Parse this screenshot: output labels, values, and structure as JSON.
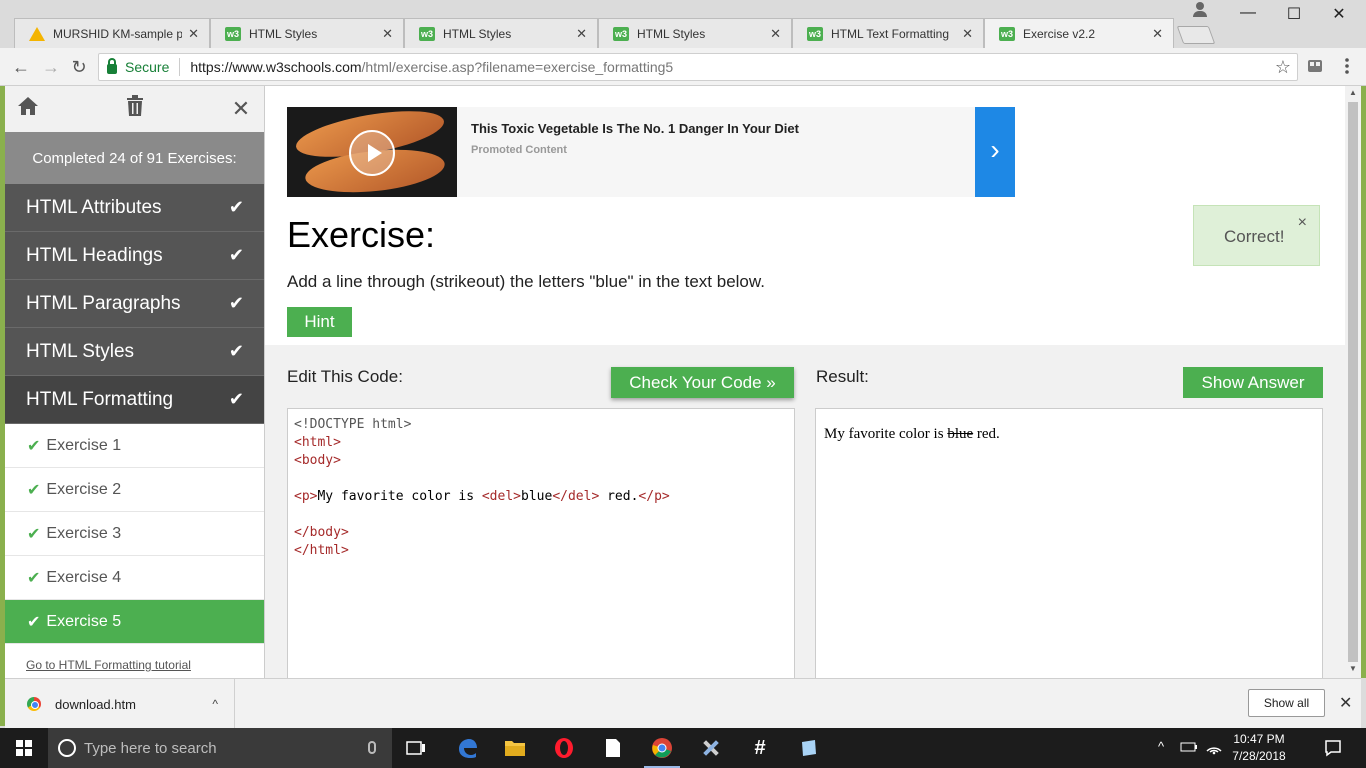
{
  "browser": {
    "tabs": [
      {
        "label": "MURSHID KM-sample pr",
        "icon": "google-drive-icon"
      },
      {
        "label": "HTML Styles",
        "icon": "w3schools-icon"
      },
      {
        "label": "HTML Styles",
        "icon": "w3schools-icon"
      },
      {
        "label": "HTML Styles",
        "icon": "w3schools-icon"
      },
      {
        "label": "HTML Text Formatting",
        "icon": "w3schools-icon"
      },
      {
        "label": "Exercise v2.2",
        "icon": "w3schools-icon",
        "active": true
      }
    ],
    "tab_close": "✕",
    "favicon_text": "w3",
    "address": {
      "secure_label": "Secure",
      "url_host": "https://www.w3schools.com",
      "url_path": "/html/exercise.asp?filename=exercise_formatting5"
    },
    "window_controls": {
      "minimize": "—",
      "maximize": "☐",
      "close": "✕"
    },
    "nav": {
      "back": "←",
      "forward": "→",
      "reload": "↻",
      "star": "☆"
    }
  },
  "sidebar": {
    "icons": {
      "home": "⌂",
      "trash": "🗑",
      "close": "✕"
    },
    "progress_text": "Completed 24 of 91 Exercises:",
    "chapters": [
      {
        "label": "HTML Attributes",
        "done": true
      },
      {
        "label": "HTML Headings",
        "done": true
      },
      {
        "label": "HTML Paragraphs",
        "done": true
      },
      {
        "label": "HTML Styles",
        "done": true
      },
      {
        "label": "HTML Formatting",
        "done": true,
        "current": true
      }
    ],
    "checkmark": "✔",
    "exercises": [
      {
        "label": "Exercise 1",
        "done": true
      },
      {
        "label": "Exercise 2",
        "done": true
      },
      {
        "label": "Exercise 3",
        "done": true
      },
      {
        "label": "Exercise 4",
        "done": true
      },
      {
        "label": "Exercise 5",
        "done": true,
        "active": true
      }
    ],
    "tutorial_link": "Go to HTML Formatting tutorial"
  },
  "ad": {
    "title": "This Toxic Vegetable Is The No. 1 Danger In Your Diet",
    "subtitle": "Promoted Content",
    "arrow": "›"
  },
  "exercise": {
    "heading": "Exercise:",
    "instruction": "Add a line through (strikeout) the letters \"blue\" in the text below.",
    "hint_label": "Hint",
    "correct_message": "Correct!",
    "correct_close": "×"
  },
  "editor": {
    "label": "Edit This Code:",
    "check_label": "Check Your Code »",
    "code": {
      "line1": "<!DOCTYPE html>",
      "html_open": "<html>",
      "body_open": "<body>",
      "p_open": "<p>",
      "text_before": "My favorite color is ",
      "del_open": "<del>",
      "del_text": "blue",
      "del_close": "</del>",
      "text_after": " red.",
      "p_close": "</p>",
      "body_close": "</body>",
      "html_close": "</html>"
    }
  },
  "result": {
    "label": "Result:",
    "answer_label": "Show Answer",
    "text_before": "My favorite color is ",
    "struck": "blue",
    "text_after": " red."
  },
  "downloads": {
    "file_name": "download.htm",
    "chevron": "^",
    "show_all": "Show all",
    "close": "✕"
  },
  "taskbar": {
    "search_placeholder": "Type here to search",
    "clock_time": "10:47 PM",
    "clock_date": "7/28/2018"
  }
}
